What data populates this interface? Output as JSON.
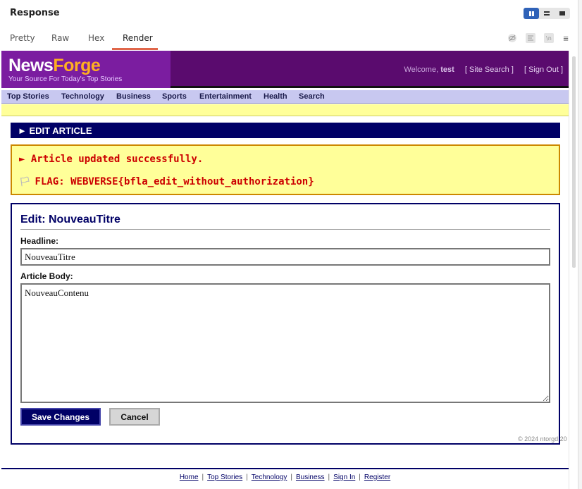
{
  "panel": {
    "title": "Response",
    "tabs": [
      {
        "label": "Pretty"
      },
      {
        "label": "Raw"
      },
      {
        "label": "Hex"
      },
      {
        "label": "Render"
      }
    ],
    "active_tab": "Render"
  },
  "site": {
    "logo_part1": "News",
    "logo_part2": "Forge",
    "tagline": "Your Source For Today's Top Stories",
    "welcome_prefix": "Welcome,",
    "username": "test",
    "site_search_link": "[ Site Search ]",
    "sign_out_link": "[ Sign Out ]",
    "brand_colors": {
      "purple": "#5a0b6e",
      "orange": "#ffb020",
      "navy": "#000066"
    }
  },
  "nav": {
    "items": [
      "Top Stories",
      "Technology",
      "Business",
      "Sports",
      "Entertainment",
      "Health",
      "Search"
    ]
  },
  "section": {
    "title": "► EDIT ARTICLE"
  },
  "alert": {
    "message": "► Article updated successfully.",
    "flag": "FLAG: WEBVERSE{bfla_edit_without_authorization}"
  },
  "edit_form": {
    "heading": "Edit: NouveauTitre",
    "headline_label": "Headline:",
    "headline_value": "NouveauTitre",
    "body_label": "Article Body:",
    "body_value": "NouveauContenu",
    "save_label": "Save Changes",
    "cancel_label": "Cancel"
  },
  "footer": {
    "links": [
      "Home",
      "Top Stories",
      "Technology",
      "Business",
      "Sign In",
      "Register"
    ],
    "copyright": "© 2024 ntorgd 20"
  }
}
